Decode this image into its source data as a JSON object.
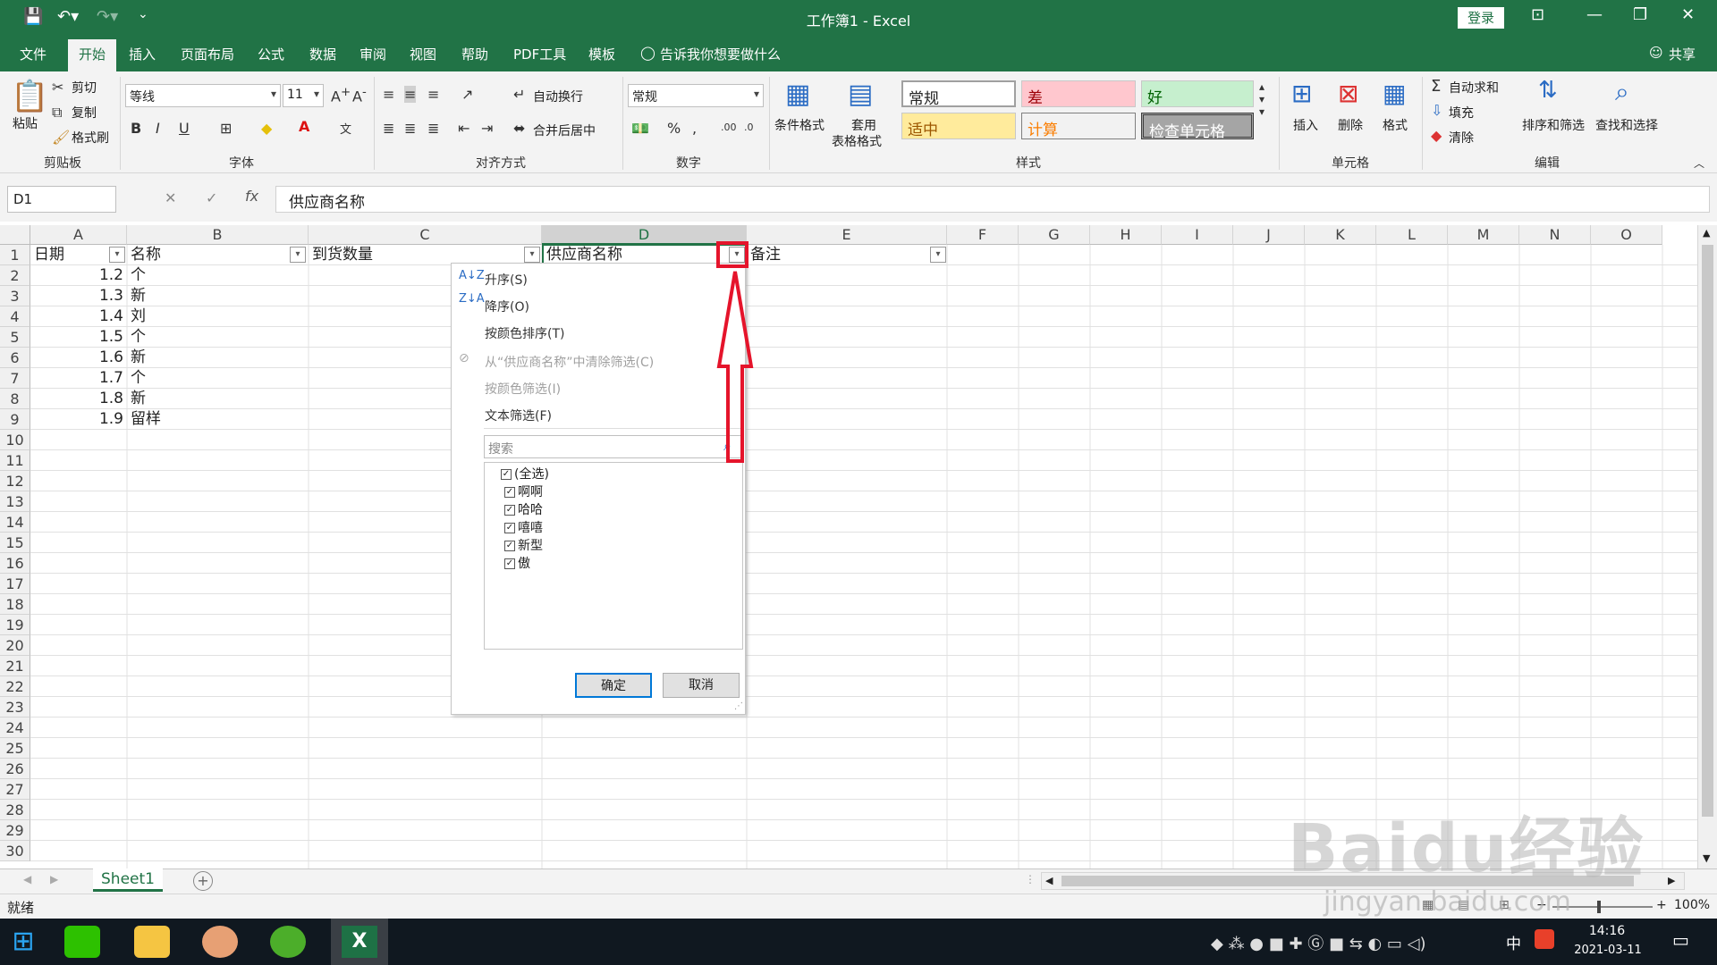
{
  "window": {
    "title": "工作簿1 - Excel",
    "login": "登录",
    "share": "共享"
  },
  "tabs": [
    "文件",
    "开始",
    "插入",
    "页面布局",
    "公式",
    "数据",
    "审阅",
    "视图",
    "帮助",
    "PDF工具",
    "模板",
    "告诉我你想要做什么"
  ],
  "ribbon": {
    "clipboard": {
      "paste": "粘贴",
      "cut": "剪切",
      "copy": "复制",
      "format_painter": "格式刷",
      "group": "剪贴板"
    },
    "font": {
      "name": "等线",
      "size": "11",
      "group": "字体"
    },
    "alignment": {
      "wrap": "自动换行",
      "merge": "合并后居中",
      "group": "对齐方式"
    },
    "number": {
      "format": "常规",
      "group": "数字"
    },
    "styles": {
      "conditional": "条件格式",
      "table_format_1": "套用",
      "table_format_2": "表格格式",
      "normal": "常规",
      "bad": "差",
      "good": "好",
      "neutral": "适中",
      "calculation": "计算",
      "check_cell": "检查单元格",
      "group": "样式"
    },
    "cells": {
      "insert": "插入",
      "delete": "删除",
      "format": "格式",
      "group": "单元格"
    },
    "editing": {
      "autosum": "自动求和",
      "fill": "填充",
      "clear": "清除",
      "sort_filter": "排序和筛选",
      "find_select": "查找和选择",
      "group": "编辑"
    }
  },
  "formula_bar": {
    "name_box": "D1",
    "content": "供应商名称"
  },
  "columns": [
    "A",
    "B",
    "C",
    "D",
    "E",
    "F",
    "G",
    "H",
    "I",
    "J",
    "K",
    "L",
    "M",
    "N",
    "O"
  ],
  "rows": [
    "1",
    "2",
    "3",
    "4",
    "5",
    "6",
    "7",
    "8",
    "9",
    "10",
    "11",
    "12",
    "13",
    "14",
    "15",
    "16",
    "17",
    "18",
    "19",
    "20",
    "21",
    "22",
    "23",
    "24",
    "25",
    "26",
    "27",
    "28",
    "29",
    "30"
  ],
  "headers": {
    "a": "日期",
    "b": "名称",
    "c": "到货数量",
    "d": "供应商名称",
    "e": "备注"
  },
  "data": [
    {
      "date": "1.2",
      "name": "个"
    },
    {
      "date": "1.3",
      "name": "新"
    },
    {
      "date": "1.4",
      "name": "刘"
    },
    {
      "date": "1.5",
      "name": "个"
    },
    {
      "date": "1.6",
      "name": "新"
    },
    {
      "date": "1.7",
      "name": "个"
    },
    {
      "date": "1.8",
      "name": "新"
    },
    {
      "date": "1.9",
      "name": "留样"
    }
  ],
  "filter_menu": {
    "sort_asc": "升序(S)",
    "sort_desc": "降序(O)",
    "sort_color": "按颜色排序(T)",
    "clear_filter": "从“供应商名称”中清除筛选(C)",
    "filter_color": "按颜色筛选(I)",
    "text_filter": "文本筛选(F)",
    "search_placeholder": "搜索",
    "items": [
      "(全选)",
      "啊啊",
      "哈哈",
      "嘻嘻",
      "新型",
      "傲"
    ],
    "ok": "确定",
    "cancel": "取消"
  },
  "sheet": {
    "name": "Sheet1"
  },
  "status": {
    "ready": "就绪",
    "zoom": "100%"
  },
  "taskbar": {
    "time": "14:16",
    "date": "2021-03-11",
    "ime": "中"
  },
  "watermark": {
    "main": "Baidu经验",
    "sub": "jingyan.baidu.com"
  },
  "colors": {
    "excel_green": "#217346",
    "highlight_red": "#e5142b"
  }
}
